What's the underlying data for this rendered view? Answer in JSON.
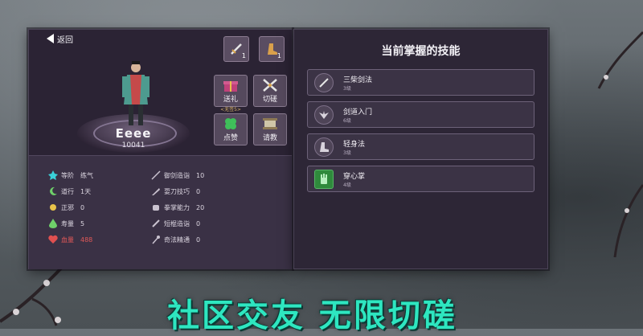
{
  "header": {
    "back_label": "返回"
  },
  "character": {
    "name": "Eeee",
    "id": "10041"
  },
  "slots": [
    {
      "icon": "sword-icon",
      "count": "1"
    },
    {
      "icon": "boot-icon",
      "count": "1"
    }
  ],
  "actions": [
    {
      "icon": "gift-icon",
      "label": "送礼",
      "sub": "<无签5>"
    },
    {
      "icon": "crossed-swords-icon",
      "label": "切磋",
      "sub": ""
    },
    {
      "icon": "clover-icon",
      "label": "点赞",
      "sub": ""
    },
    {
      "icon": "scroll-icon",
      "label": "请教",
      "sub": ""
    }
  ],
  "stats_left": [
    {
      "icon": "rank-icon",
      "label": "等阶",
      "value": "练气",
      "color": "#3ad0d8"
    },
    {
      "icon": "moon-icon",
      "label": "道行",
      "value": "1天",
      "color": "#6fd06a"
    },
    {
      "icon": "sun-icon",
      "label": "正邪",
      "value": "0",
      "color": "#e8c34a"
    },
    {
      "icon": "drop-icon",
      "label": "寿量",
      "value": "5",
      "color": "#6fd06a"
    },
    {
      "icon": "heart-icon",
      "label": "血量",
      "value": "488",
      "color": "#e05050"
    }
  ],
  "stats_right": [
    {
      "icon": "sword-icon",
      "label": "御剑造诣",
      "value": "10"
    },
    {
      "icon": "sword-icon",
      "label": "耍刀技巧",
      "value": "0"
    },
    {
      "icon": "fist-icon",
      "label": "拳掌能力",
      "value": "20"
    },
    {
      "icon": "dagger-icon",
      "label": "短棍造诣",
      "value": "0"
    },
    {
      "icon": "staff-icon",
      "label": "奇法精通",
      "value": "0"
    }
  ],
  "skills_panel": {
    "title": "当前掌握的技能",
    "skills": [
      {
        "icon": "sword-icon",
        "name": "三柴剑法",
        "level": "3级"
      },
      {
        "icon": "wings-icon",
        "name": "剑道入门",
        "level": "6级"
      },
      {
        "icon": "boot-icon",
        "name": "轻身法",
        "level": "3级"
      },
      {
        "icon": "palm-icon",
        "name": "穿心掌",
        "level": "4级"
      }
    ]
  },
  "slogan": "社区交友  无限切磋"
}
